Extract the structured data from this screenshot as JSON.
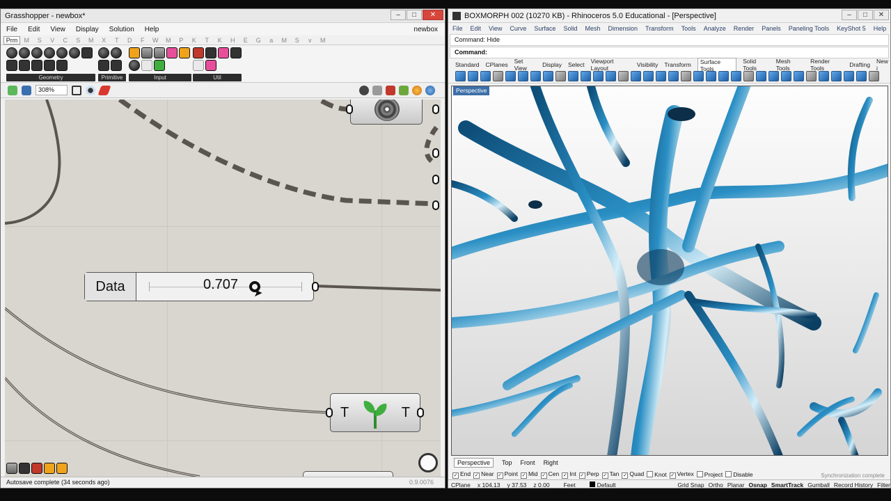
{
  "grasshopper": {
    "title": "Grasshopper - newbox*",
    "menu": [
      "File",
      "Edit",
      "View",
      "Display",
      "Solution",
      "Help"
    ],
    "doc_name": "newbox",
    "category_tabs": [
      "Prm",
      "M",
      "S",
      "V",
      "C",
      "S",
      "M",
      "X",
      "T",
      "D",
      "F",
      "W",
      "M",
      "P",
      "K",
      "T",
      "K",
      "H",
      "E",
      "G",
      "a",
      "M",
      "S",
      "v",
      "M"
    ],
    "groups": [
      "Geometry",
      "Primitive",
      "Input",
      "Util"
    ],
    "zoom": "308%",
    "slider": {
      "name": "Data",
      "value": "0.707"
    },
    "sprout_labels": {
      "left": "T",
      "right": "T"
    },
    "status": "Autosave complete (34 seconds ago)",
    "version": "0.9.0076"
  },
  "rhino": {
    "title": "BOXMORPH 002 (10270 KB) - Rhinoceros 5.0 Educational - [Perspective]",
    "menu": [
      "File",
      "Edit",
      "View",
      "Curve",
      "Surface",
      "Solid",
      "Mesh",
      "Dimension",
      "Transform",
      "Tools",
      "Analyze",
      "Render",
      "Panels",
      "Paneling Tools",
      "KeyShot 5",
      "Help"
    ],
    "command_history": "Command: Hide",
    "command_prompt": "Command:",
    "toolbar_tabs": [
      "Standard",
      "CPlanes",
      "Set View",
      "Display",
      "Select",
      "Viewport Layout",
      "Visibility",
      "Transform",
      "Surface Tools",
      "Solid Tools",
      "Mesh Tools",
      "Render Tools",
      "Drafting",
      "New i"
    ],
    "active_toolbar_tab": "Surface Tools",
    "viewport_label": "Perspective",
    "viewport_tabs": [
      "Perspective",
      "Top",
      "Front",
      "Right"
    ],
    "osnaps": [
      "End",
      "Near",
      "Point",
      "Mid",
      "Cen",
      "Int",
      "Perp",
      "Tan",
      "Quad",
      "Knot",
      "Vertex",
      "Project",
      "Disable"
    ],
    "osnap_checked": [
      true,
      true,
      true,
      true,
      true,
      true,
      true,
      true,
      true,
      false,
      true,
      false,
      false
    ],
    "sync": "Synchronization complete",
    "status": {
      "cplane": "CPlane",
      "x": "x 104.13",
      "y": "y 37.53",
      "z": "z 0.00",
      "units": "Feet",
      "layer": "Default",
      "toggles": [
        "Grid Snap",
        "Ortho",
        "Planar",
        "Osnap",
        "SmartTrack",
        "Gumball",
        "Record History",
        "Filter"
      ]
    }
  },
  "colors": {
    "rhino_geometry": "#1a6fa0",
    "canvas": "#d9d6cf",
    "wire": "#5b5550"
  }
}
